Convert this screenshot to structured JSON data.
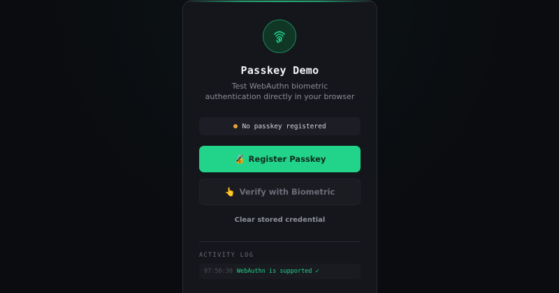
{
  "app": {
    "title": "Passkey Demo",
    "subtitle": "Test WebAuthn biometric authentication directly in your browser"
  },
  "status": {
    "text": "No passkey registered",
    "dot_color": "#e8a23a"
  },
  "actions": {
    "register_emoji": "🔏",
    "register_label": "Register Passkey",
    "verify_emoji": "👆",
    "verify_label": "Verify with Biometric",
    "clear_label": "Clear stored credential"
  },
  "log": {
    "heading": "ACTIVITY LOG",
    "entries": [
      {
        "time": "07:50:30",
        "message": "WebAuthn is supported ✓"
      }
    ]
  },
  "colors": {
    "accent": "#22d38a",
    "card_bg": "#15161c",
    "page_bg": "#0b0c10"
  },
  "icons": {
    "logo": "fingerprint-icon",
    "status": "status-dot-icon"
  }
}
